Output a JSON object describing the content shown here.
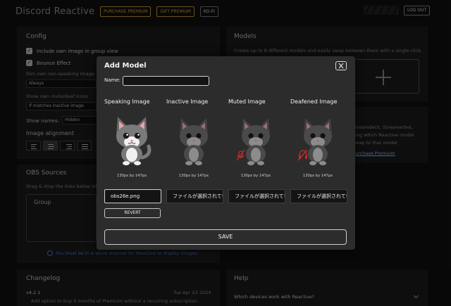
{
  "header": {
    "title": "Discord Reactive",
    "purchase_premium": "PURCHASE PREMIUM",
    "gift_premium": "GIFT PREMIUM",
    "lang": "KO-FI",
    "logout": "LOG OUT"
  },
  "config": {
    "title": "Config",
    "own_image_group": "Include own image in group view",
    "bounce_effect": "Bounce Effect",
    "dim_label": "Dim own non-speaking image",
    "dim_value": "Always",
    "mute_label": "Show own mute/deaf icons",
    "mute_value": "If matches inactive image",
    "names_label": "Show names:",
    "names_value": "Hidden",
    "alignment_label": "Image alignment"
  },
  "models": {
    "title": "Models",
    "description": "Create up to 8 different models and easily swap between them with a single click.",
    "right_lines": [
      "treamdeck, Streamerbot,",
      "ing which Reactive model",
      "wap to that model."
    ],
    "premium_link": "urchase Premium"
  },
  "obs": {
    "title": "OBS Sources",
    "description": "Drag & drop the links below into",
    "group_label": "Group",
    "notice": "You must be in a voice channel for Reactive to display images."
  },
  "changelog": {
    "title": "Changelog",
    "version": "v4.2.1",
    "date": "Tue Apr 23 2024",
    "item": "Add option to buy 3 months of Premium without a recurring subscription."
  },
  "help": {
    "title": "Help",
    "question": "Which devices work with Reactive?"
  },
  "modal": {
    "title": "Add Model",
    "name_label": "Name:",
    "name_value": "",
    "columns": [
      {
        "label": "Speaking Image",
        "dims": "130px by 147px",
        "file": "obs26e.png"
      },
      {
        "label": "Inactive Image",
        "dims": "130px by 147px",
        "file": "ファイルが選択されていません"
      },
      {
        "label": "Muted Image",
        "dims": "130px by 147px",
        "file": "ファイルが選択されていません"
      },
      {
        "label": "Deafened Image",
        "dims": "130px by 147px",
        "file": "ファイルが選択されていません"
      }
    ],
    "revert": "REVERT",
    "save": "SAVE"
  },
  "colors": {
    "accent_gold": "#c9952c",
    "background": "#101010",
    "panel": "#1b1b1b",
    "modal": "#2c2c2c",
    "mute_red": "#c42b2b"
  }
}
